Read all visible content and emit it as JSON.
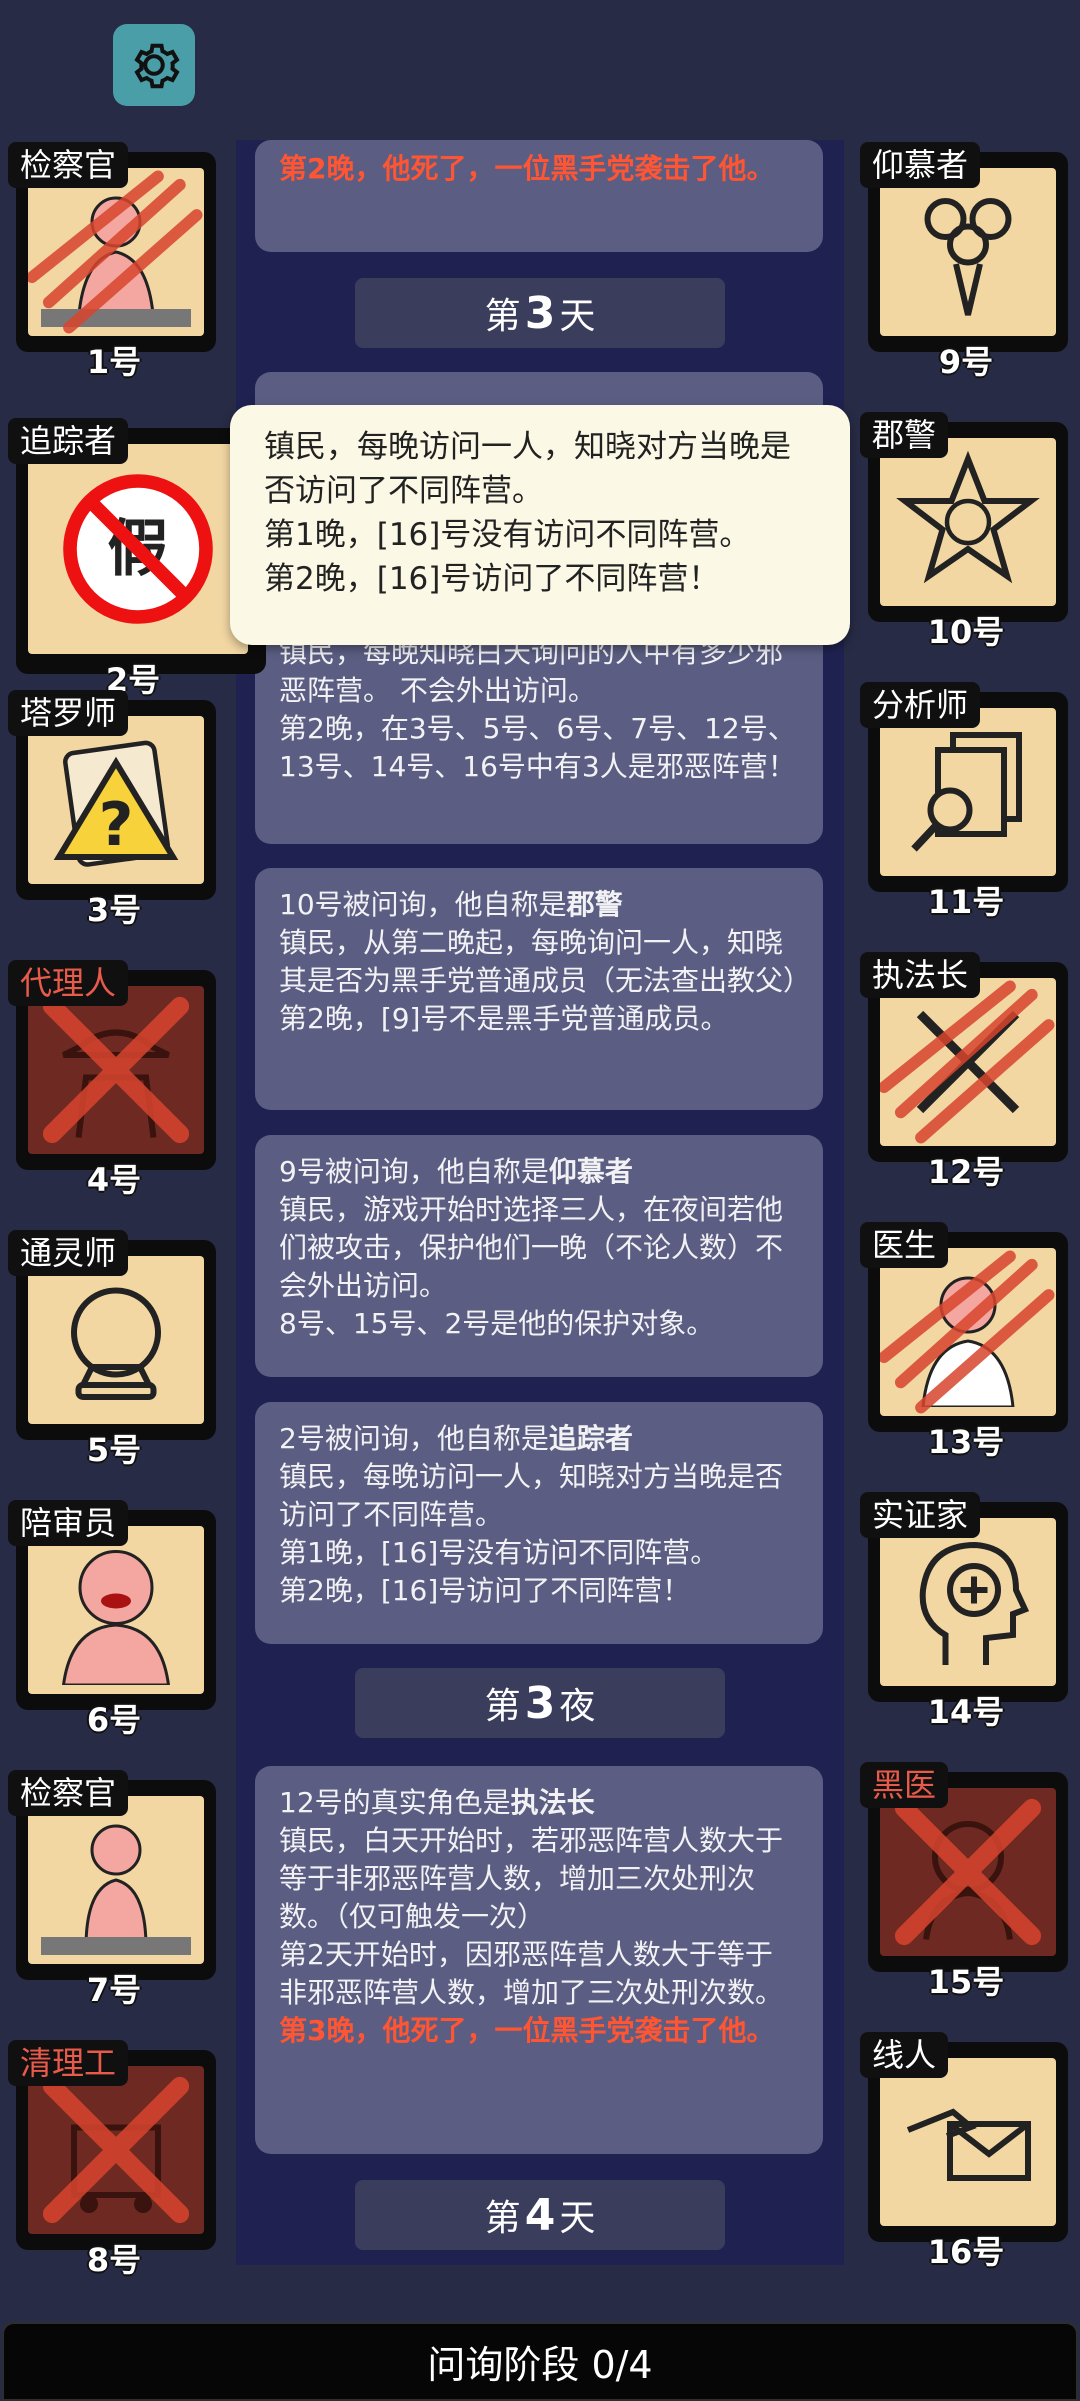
{
  "header": {
    "settings_icon": "gear-icon"
  },
  "players_left": [
    {
      "role": "检察官",
      "number": "1号",
      "icon": "prosecutor-figure-icon",
      "status": "attacked",
      "faction": "town"
    },
    {
      "role": "追踪者",
      "number": "2号",
      "icon": "fake-stamp-icon",
      "status": "fake",
      "faction": "town"
    },
    {
      "role": "塔罗师",
      "number": "3号",
      "icon": "tarot-question-icon",
      "status": "alive",
      "faction": "town"
    },
    {
      "role": "代理人",
      "number": "4号",
      "icon": "agent-hat-icon",
      "status": "dead",
      "faction": "evil"
    },
    {
      "role": "通灵师",
      "number": "5号",
      "icon": "crystal-ball-icon",
      "status": "alive",
      "faction": "town"
    },
    {
      "role": "陪审员",
      "number": "6号",
      "icon": "juror-figure-icon",
      "status": "alive",
      "faction": "town"
    },
    {
      "role": "检察官",
      "number": "7号",
      "icon": "prosecutor-figure-icon",
      "status": "alive",
      "faction": "town"
    },
    {
      "role": "清理工",
      "number": "8号",
      "icon": "cleaner-cart-icon",
      "status": "dead",
      "faction": "evil"
    }
  ],
  "players_right": [
    {
      "role": "仰慕者",
      "number": "9号",
      "icon": "bouquet-icon",
      "status": "alive",
      "faction": "town"
    },
    {
      "role": "郡警",
      "number": "10号",
      "icon": "sheriff-badge-icon",
      "status": "alive",
      "faction": "town"
    },
    {
      "role": "分析师",
      "number": "11号",
      "icon": "documents-magnifier-icon",
      "status": "alive",
      "faction": "town"
    },
    {
      "role": "执法长",
      "number": "12号",
      "icon": "crossed-tools-icon",
      "status": "attacked",
      "faction": "town"
    },
    {
      "role": "医生",
      "number": "13号",
      "icon": "doctor-figure-icon",
      "status": "attacked",
      "faction": "town"
    },
    {
      "role": "实证家",
      "number": "14号",
      "icon": "head-plus-icon",
      "status": "alive",
      "faction": "town"
    },
    {
      "role": "黑医",
      "number": "15号",
      "icon": "black-doctor-icon",
      "status": "dead",
      "faction": "evil"
    },
    {
      "role": "线人",
      "number": "16号",
      "icon": "hand-envelope-icon",
      "status": "alive",
      "faction": "town"
    }
  ],
  "log": {
    "top_card_partial": "第2晚，他死了，一位黑手党袭击了他。",
    "day3_label": {
      "prefix": "第",
      "num": "3",
      "suffix": "天"
    },
    "card_analyst_partial": "镇民，每晚知晓白天询问的人中有多少邪恶阵营。 不会外出访问。",
    "card_analyst_result": "第2晚，在3号、5号、6号、7号、12号、13号、14号、16号中有3人是邪恶阵营！",
    "card_10": {
      "lead": "10号被问询，他自称是",
      "role": "郡警",
      "desc": "镇民，从第二晚起，每晚询问一人，知晓其是否为黑手党普通成员（无法查出教父）",
      "result": "第2晚，[9]号不是黑手党普通成员。"
    },
    "card_9": {
      "lead": "9号被问询，他自称是",
      "role": "仰慕者",
      "desc": "镇民，游戏开始时选择三人，在夜间若他们被攻击，保护他们一晚（不论人数）不会外出访问。",
      "result": "8号、15号、2号是他的保护对象。"
    },
    "card_2": {
      "lead": "2号被问询，他自称是",
      "role": "追踪者",
      "desc": "镇民，每晚访问一人，知晓对方当晚是否访问了不同阵营。",
      "r1": "第1晚，[16]号没有访问不同阵营。",
      "r2": "第2晚，[16]号访问了不同阵营！"
    },
    "night3_label": {
      "prefix": "第",
      "num": "3",
      "suffix": "夜"
    },
    "card_12": {
      "lead": "12号的真实角色是",
      "role": "执法长",
      "desc": "镇民，白天开始时，若邪恶阵营人数大于等于非邪恶阵营人数，增加三次处刑次数。（仅可触发一次）",
      "result": "第2天开始时，因邪恶阵营人数大于等于非邪恶阵营人数，增加了三次处刑次数。",
      "death": "第3晚，他死了，一位黑手党袭击了他。"
    },
    "day4_label": {
      "prefix": "第",
      "num": "4",
      "suffix": "天"
    }
  },
  "tooltip": {
    "line1": "镇民，每晚访问一人，知晓对方当晚是否访问了不同阵营。",
    "line2": "第1晚，[16]号没有访问不同阵营。",
    "line3": "第2晚，[16]号访问了不同阵营！"
  },
  "bottom": {
    "phase_label": "问询阶段 0/4"
  },
  "colors": {
    "background": "#272b45",
    "card_art": "#f2d7a3",
    "dead_art": "#6e2a22",
    "death_text": "#ff5533",
    "evil_role": "#e85a4a"
  }
}
